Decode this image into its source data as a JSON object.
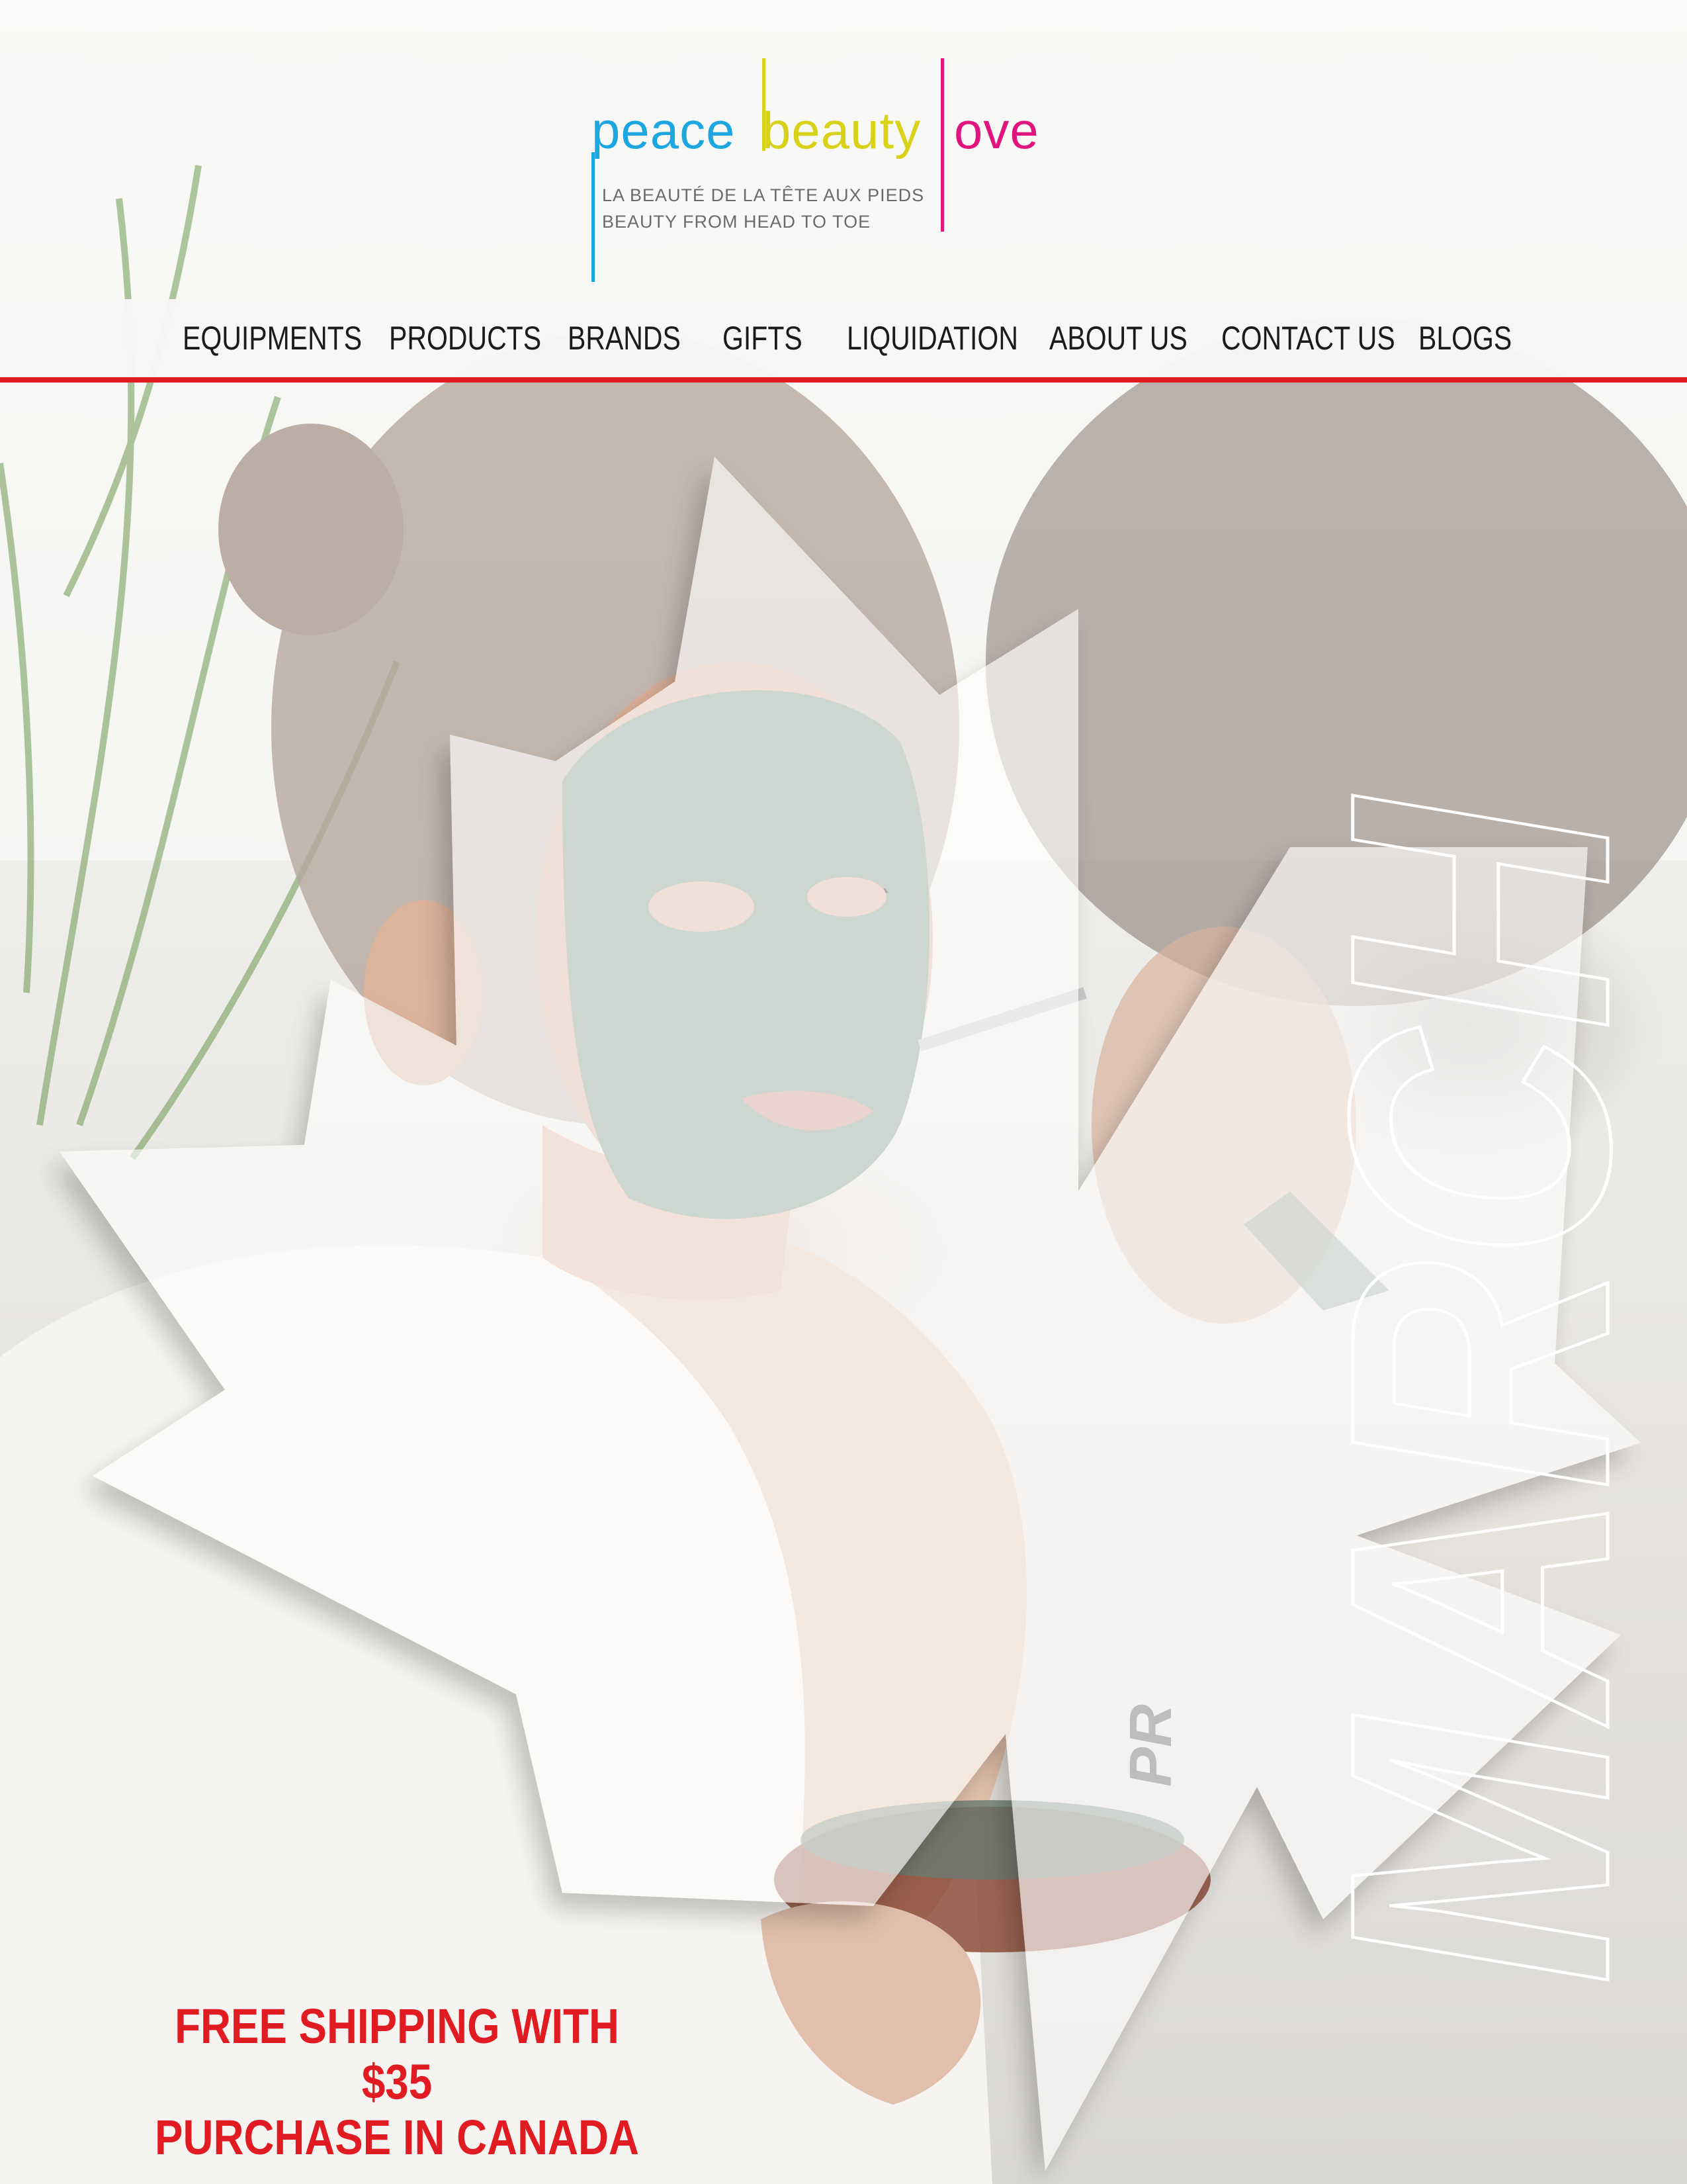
{
  "logo": {
    "word_peace": "peace",
    "word_beauty": "beauty",
    "word_love": "ove",
    "tagline_fr": "LA BEAUTÉ DE LA TÊTE AUX PIEDS",
    "tagline_en": "BEAUTY FROM HEAD TO TOE"
  },
  "nav": {
    "items": [
      {
        "label": "EQUIPMENTS"
      },
      {
        "label": "PRODUCTS"
      },
      {
        "label": "BRANDS"
      },
      {
        "label": "GIFTS"
      },
      {
        "label": "LIQUIDATION"
      },
      {
        "label": "ABOUT US"
      },
      {
        "label": "CONTACT US"
      },
      {
        "label": "BLOGS"
      }
    ]
  },
  "hero": {
    "month_text": "MARCH",
    "prefix_text": "PR"
  },
  "promo": {
    "line1": "FREE SHIPPING WITH $35",
    "line2": "PURCHASE IN CANADA"
  },
  "colors": {
    "accent_red": "#e11b22",
    "logo_blue": "#1ea6e0",
    "logo_yellow": "#d8d21a",
    "logo_pink": "#e0157d",
    "mask_green": "#7f9486"
  }
}
